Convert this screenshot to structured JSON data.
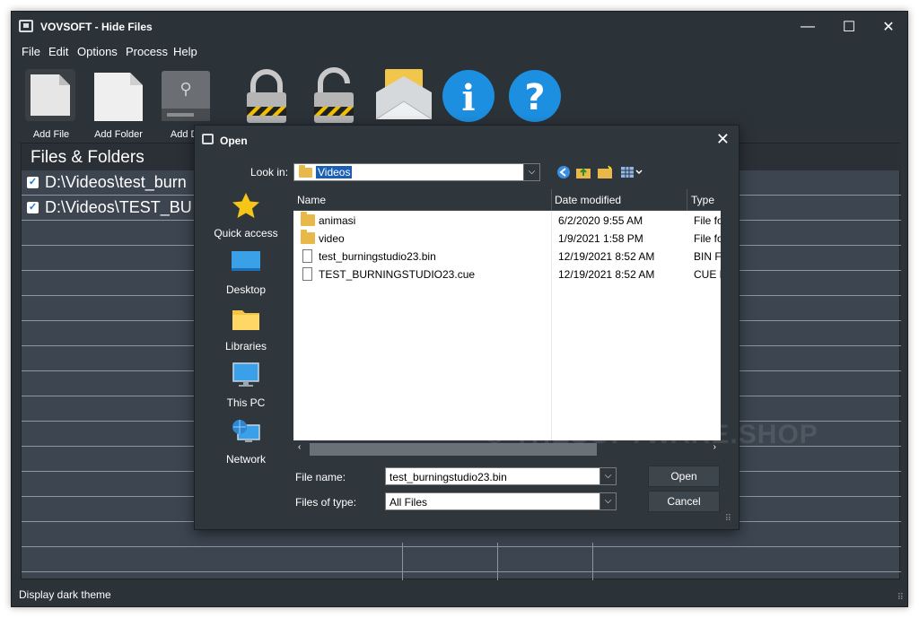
{
  "app": {
    "title": "VOVSOFT - Hide Files",
    "window_controls": {
      "minimize": "—",
      "maximize": "☐",
      "close": "✕"
    }
  },
  "menu": [
    "File",
    "Edit",
    "Options",
    "Process",
    "Help"
  ],
  "toolbar": {
    "buttons": [
      {
        "label": "Add File",
        "icon": "file-icon"
      },
      {
        "label": "Add Folder",
        "icon": "folder-icon"
      },
      {
        "label": "Add Dr",
        "icon": "drive-icon"
      },
      {
        "label": "",
        "icon": "lock-closed-icon"
      },
      {
        "label": "",
        "icon": "lock-open-icon"
      },
      {
        "label": "",
        "icon": "envelope-icon"
      },
      {
        "label": "",
        "icon": "info-icon"
      },
      {
        "label": "",
        "icon": "help-icon"
      }
    ]
  },
  "panel": {
    "title": "Files & Folders",
    "items": [
      {
        "checked": true,
        "path": "D:\\Videos\\test_burn"
      },
      {
        "checked": true,
        "path": "D:\\Videos\\TEST_BU"
      }
    ]
  },
  "status": {
    "text": "Display dark theme"
  },
  "dialog": {
    "title": "Open",
    "look_in_label": "Look in:",
    "look_in_value": "Videos",
    "places": [
      "Quick access",
      "Desktop",
      "Libraries",
      "This PC",
      "Network"
    ],
    "columns": {
      "name": "Name",
      "date": "Date modified",
      "type": "Type"
    },
    "files": [
      {
        "name": "animasi",
        "date": "6/2/2020 9:55 AM",
        "type": "File fo",
        "kind": "folder"
      },
      {
        "name": "video",
        "date": "1/9/2021 1:58 PM",
        "type": "File fo",
        "kind": "folder"
      },
      {
        "name": "test_burningstudio23.bin",
        "date": "12/19/2021 8:52 AM",
        "type": "BIN F",
        "kind": "file"
      },
      {
        "name": "TEST_BURNINGSTUDIO23.cue",
        "date": "12/19/2021 8:52 AM",
        "type": "CUE F",
        "kind": "file"
      }
    ],
    "file_name_label": "File name:",
    "file_name_value": "test_burningstudio23.bin",
    "files_of_type_label": "Files of type:",
    "files_of_type_value": "All Files",
    "open_button": "Open",
    "cancel_button": "Cancel",
    "watermark": "© THESOFTWARE.SHOP"
  },
  "colors": {
    "window_bg": "#2b3238",
    "panel_bg": "#3c4550",
    "accent": "#1a5fb4",
    "help_blue": "#1d8fe0",
    "folder": "#e8b84a"
  }
}
